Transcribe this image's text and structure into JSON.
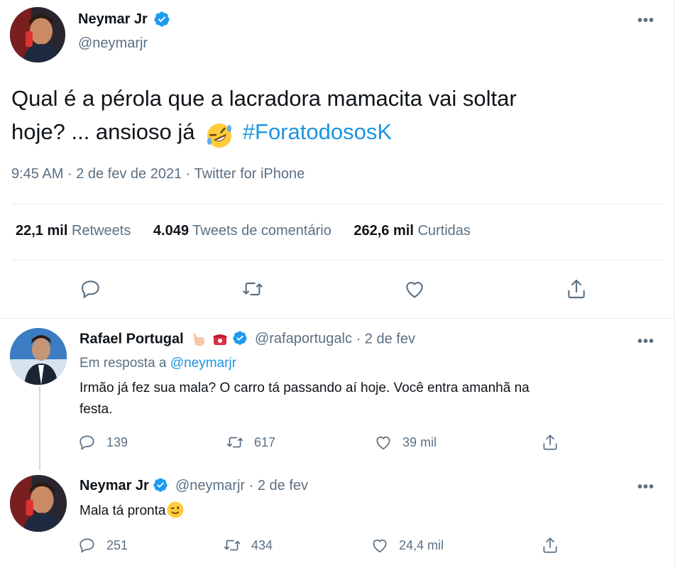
{
  "main_tweet": {
    "author_name": "Neymar Jr",
    "author_handle": "@neymarjr",
    "text_part1": "Qual é a pérola que a lacradora mamacita vai soltar",
    "text_part2": "hoje? ... ansioso já",
    "hashtag": "#ForatodososK",
    "time": "9:45 AM",
    "date": "2 de fev de 2021",
    "source": "Twitter for iPhone",
    "retweets_count": "22,1 mil",
    "retweets_label": "Retweets",
    "comments_count": "4.049",
    "comments_label": "Tweets de comentário",
    "likes_count": "262,6 mil",
    "likes_label": "Curtidas"
  },
  "replies": [
    {
      "author_name": "Rafael Portugal",
      "author_handle": "@rafaportugalc",
      "date": "2 de fev",
      "reply_to_label": "Em resposta a",
      "reply_to_handle": "@neymarjr",
      "text_line1": "Irmão já fez sua mala? O carro tá passando aí hoje. Você entra amanhã na",
      "text_line2": "festa.",
      "replies": "139",
      "retweets": "617",
      "likes": "39 mil"
    },
    {
      "author_name": "Neymar Jr",
      "author_handle": "@neymarjr",
      "date": "2 de fev",
      "text_line1": "Mala tá pronta",
      "replies": "251",
      "retweets": "434",
      "likes": "24,4 mil"
    }
  ],
  "ui": {
    "more_glyph": "•••",
    "dot_sep": "·"
  },
  "icons": {
    "verified": "verified-badge-icon",
    "reply": "reply-icon",
    "retweet": "retweet-icon",
    "like": "heart-icon",
    "share": "share-icon"
  },
  "colors": {
    "accent": "#1b95e0",
    "muted": "#5b7083",
    "text": "#0f1419"
  }
}
